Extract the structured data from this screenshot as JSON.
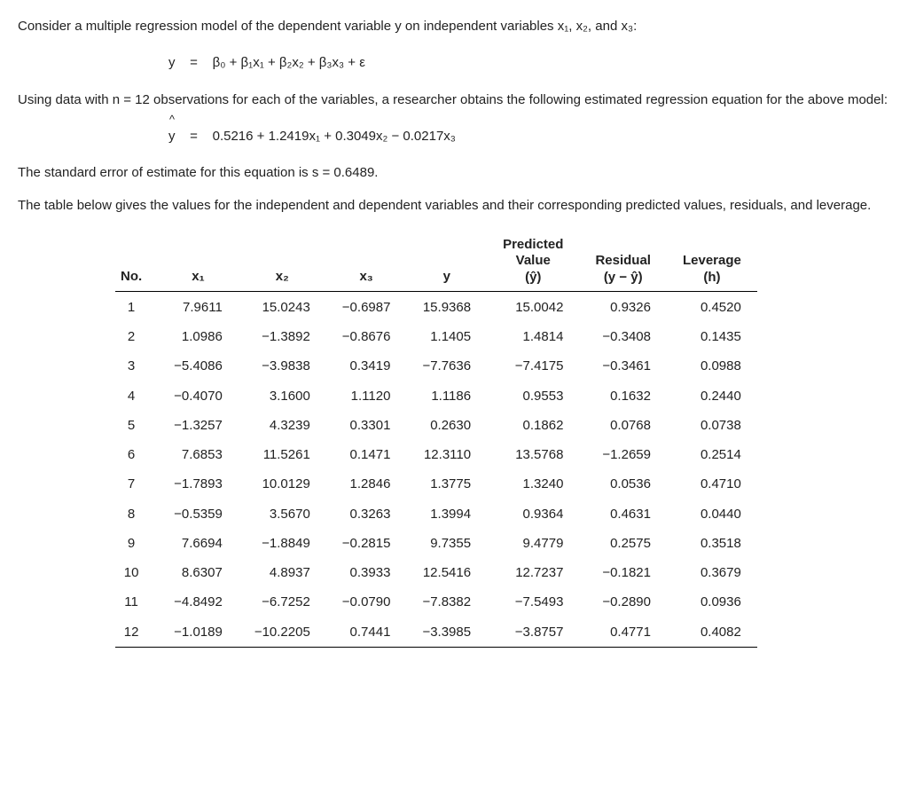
{
  "intro1": "Consider a multiple regression model of the dependent variable y on independent variables x₁, x₂, and x₃:",
  "eq_model_lhs": "y",
  "eq_model_eq": "=",
  "eq_model_rhs": "β₀ + β₁x₁ + β₂x₂ + β₃x₃ + ε",
  "intro2": "Using data with n = 12 observations for each of the variables, a researcher obtains the following estimated regression equation for the above model:",
  "eq_est_lhs": "y",
  "eq_est_eq": "=",
  "eq_est_rhs": "0.5216 + 1.2419x₁ + 0.3049x₂ − 0.0217x₃",
  "intro3": "The standard error of estimate for this equation is s = 0.6489.",
  "intro4": "The table below gives the values for the independent and dependent variables and their corresponding predicted values, residuals, and leverage.",
  "headers": {
    "no": "No.",
    "x1": "x₁",
    "x2": "x₂",
    "x3": "x₃",
    "y": "y",
    "pred_top": "Predicted",
    "pred_mid": "Value",
    "pred_sym": "(ŷ)",
    "resid_top": "Residual",
    "resid_sym": "(y − ŷ)",
    "lev_top": "Leverage",
    "lev_sym": "(h)"
  },
  "rows": [
    {
      "no": "1",
      "x1": "7.9611",
      "x2": "15.0243",
      "x3": "−0.6987",
      "y": "15.9368",
      "pred": "15.0042",
      "resid": "0.9326",
      "lev": "0.4520"
    },
    {
      "no": "2",
      "x1": "1.0986",
      "x2": "−1.3892",
      "x3": "−0.8676",
      "y": "1.1405",
      "pred": "1.4814",
      "resid": "−0.3408",
      "lev": "0.1435"
    },
    {
      "no": "3",
      "x1": "−5.4086",
      "x2": "−3.9838",
      "x3": "0.3419",
      "y": "−7.7636",
      "pred": "−7.4175",
      "resid": "−0.3461",
      "lev": "0.0988"
    },
    {
      "no": "4",
      "x1": "−0.4070",
      "x2": "3.1600",
      "x3": "1.1120",
      "y": "1.1186",
      "pred": "0.9553",
      "resid": "0.1632",
      "lev": "0.2440"
    },
    {
      "no": "5",
      "x1": "−1.3257",
      "x2": "4.3239",
      "x3": "0.3301",
      "y": "0.2630",
      "pred": "0.1862",
      "resid": "0.0768",
      "lev": "0.0738"
    },
    {
      "no": "6",
      "x1": "7.6853",
      "x2": "11.5261",
      "x3": "0.1471",
      "y": "12.3110",
      "pred": "13.5768",
      "resid": "−1.2659",
      "lev": "0.2514"
    },
    {
      "no": "7",
      "x1": "−1.7893",
      "x2": "10.0129",
      "x3": "1.2846",
      "y": "1.3775",
      "pred": "1.3240",
      "resid": "0.0536",
      "lev": "0.4710"
    },
    {
      "no": "8",
      "x1": "−0.5359",
      "x2": "3.5670",
      "x3": "0.3263",
      "y": "1.3994",
      "pred": "0.9364",
      "resid": "0.4631",
      "lev": "0.0440"
    },
    {
      "no": "9",
      "x1": "7.6694",
      "x2": "−1.8849",
      "x3": "−0.2815",
      "y": "9.7355",
      "pred": "9.4779",
      "resid": "0.2575",
      "lev": "0.3518"
    },
    {
      "no": "10",
      "x1": "8.6307",
      "x2": "4.8937",
      "x3": "0.3933",
      "y": "12.5416",
      "pred": "12.7237",
      "resid": "−0.1821",
      "lev": "0.3679"
    },
    {
      "no": "11",
      "x1": "−4.8492",
      "x2": "−6.7252",
      "x3": "−0.0790",
      "y": "−7.8382",
      "pred": "−7.5493",
      "resid": "−0.2890",
      "lev": "0.0936"
    },
    {
      "no": "12",
      "x1": "−1.0189",
      "x2": "−10.2205",
      "x3": "0.7441",
      "y": "−3.3985",
      "pred": "−3.8757",
      "resid": "0.4771",
      "lev": "0.4082"
    }
  ]
}
